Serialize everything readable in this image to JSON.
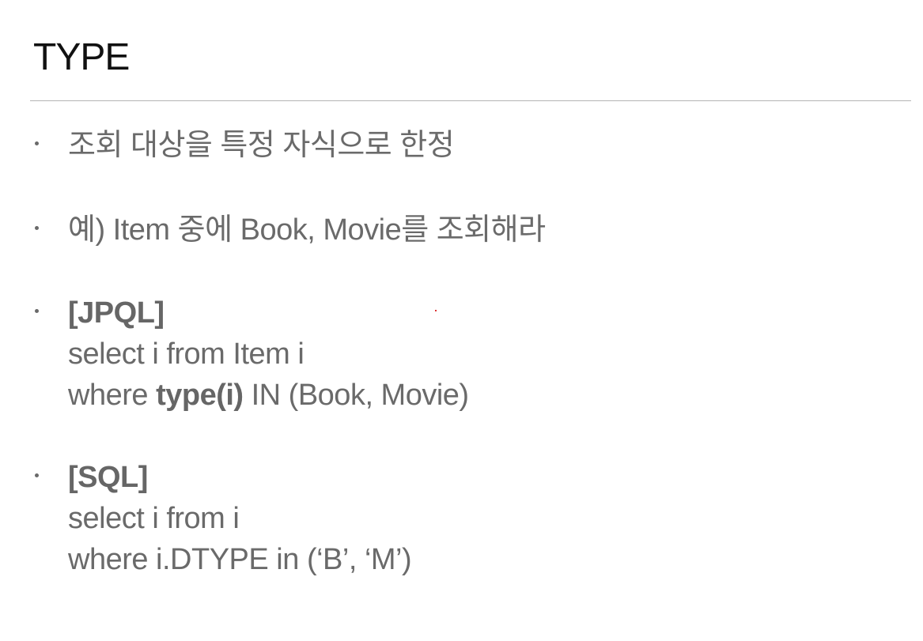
{
  "slide": {
    "title": "TYPE"
  },
  "bullets": [
    {
      "text": "조회 대상을 특정 자식으로 한정"
    },
    {
      "text": "예) Item 중에 Book, Movie를 조회해라"
    },
    {
      "heading": "[JPQL]",
      "line1": "select i from Item i",
      "line2_prefix": "where ",
      "line2_keyword": "type(i)",
      "line2_suffix": " IN (Book, Movie)"
    },
    {
      "heading": "[SQL]",
      "line1": "select i from i",
      "line2": "where i.DTYPE in (‘B’, ‘M’)"
    }
  ]
}
